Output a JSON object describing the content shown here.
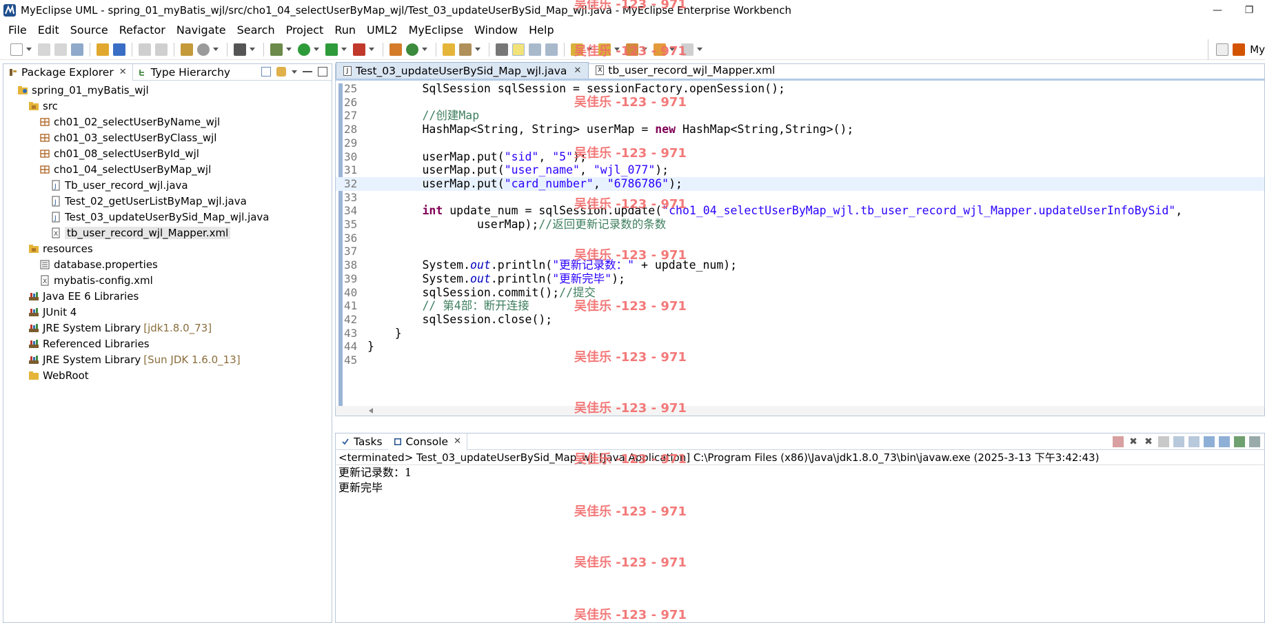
{
  "window": {
    "title": "MyEclipse UML - spring_01_myBatis_wjl/src/cho1_04_selectUserByMap_wjl/Test_03_updateUserBySid_Map_wjl.java - MyEclipse Enterprise Workbench",
    "minimize": "—",
    "restore": "❐"
  },
  "menu": [
    "File",
    "Edit",
    "Source",
    "Refactor",
    "Navigate",
    "Search",
    "Project",
    "Run",
    "UML2",
    "MyEclipse",
    "Window",
    "Help"
  ],
  "perspective": {
    "label": "My"
  },
  "left_panel": {
    "tabs": [
      {
        "label": "Package Explorer",
        "close": "✕"
      },
      {
        "label": "Type Hierarchy"
      }
    ],
    "tree": [
      {
        "label": "spring_01_myBatis_wjl",
        "icon": "project-icon",
        "indent": 0
      },
      {
        "label": "src",
        "icon": "source-folder-icon",
        "indent": 1
      },
      {
        "label": "ch01_02_selectUserByName_wjl",
        "icon": "package-icon",
        "indent": 2
      },
      {
        "label": "ch01_03_selectUserByClass_wjl",
        "icon": "package-icon",
        "indent": 2
      },
      {
        "label": "ch01_08_selectUserById_wjl",
        "icon": "package-icon",
        "indent": 2
      },
      {
        "label": "cho1_04_selectUserByMap_wjl",
        "icon": "package-icon",
        "indent": 2
      },
      {
        "label": "Tb_user_record_wjl.java",
        "icon": "java-file-icon",
        "indent": 3
      },
      {
        "label": "Test_02_getUserListByMap_wjl.java",
        "icon": "java-file-icon",
        "indent": 3
      },
      {
        "label": "Test_03_updateUserBySid_Map_wjl.java",
        "icon": "java-file-icon",
        "indent": 3
      },
      {
        "label": "tb_user_record_wjl_Mapper.xml",
        "icon": "xml-file-icon",
        "indent": 3,
        "selected": true
      },
      {
        "label": "resources",
        "icon": "source-folder-icon",
        "indent": 1
      },
      {
        "label": "database.properties",
        "icon": "properties-file-icon",
        "indent": 2
      },
      {
        "label": "mybatis-config.xml",
        "icon": "xml-file-icon",
        "indent": 2
      },
      {
        "label": "Java EE 6 Libraries",
        "icon": "library-icon",
        "indent": 1
      },
      {
        "label": "JUnit 4",
        "icon": "library-icon",
        "indent": 1
      },
      {
        "label": "JRE System Library",
        "suffix": "[jdk1.8.0_73]",
        "icon": "library-icon",
        "indent": 1
      },
      {
        "label": "Referenced Libraries",
        "icon": "library-icon",
        "indent": 1
      },
      {
        "label": "JRE System Library",
        "suffix": "[Sun JDK 1.6.0_13]",
        "icon": "library-icon",
        "indent": 1
      },
      {
        "label": "WebRoot",
        "icon": "folder-icon",
        "indent": 1
      }
    ]
  },
  "editor": {
    "tabs": [
      {
        "label": "Test_03_updateUserBySid_Map_wjl.java",
        "type": "J",
        "active": true,
        "close": "✕"
      },
      {
        "label": "tb_user_record_wjl_Mapper.xml",
        "type": "X",
        "active": false
      }
    ],
    "current_line": 32,
    "lines": [
      {
        "n": "25",
        "segs": [
          [
            "",
            "        SqlSession sqlSession = sessionFactory.openSession();"
          ]
        ]
      },
      {
        "n": "26",
        "segs": []
      },
      {
        "n": "27",
        "segs": [
          [
            "cmt",
            "        //创建Map"
          ]
        ]
      },
      {
        "n": "28",
        "segs": [
          [
            "",
            "        HashMap<String, String> userMap = "
          ],
          [
            "kw",
            "new"
          ],
          [
            "",
            " HashMap<String,String>();"
          ]
        ]
      },
      {
        "n": "29",
        "segs": []
      },
      {
        "n": "30",
        "segs": [
          [
            "",
            "        userMap.put("
          ],
          [
            "str",
            "\"sid\""
          ],
          [
            "",
            ", "
          ],
          [
            "str",
            "\"5\""
          ],
          [
            "",
            ");"
          ]
        ]
      },
      {
        "n": "31",
        "segs": [
          [
            "",
            "        userMap.put("
          ],
          [
            "str",
            "\"user_name\""
          ],
          [
            "",
            ", "
          ],
          [
            "str",
            "\"wjl_077\""
          ],
          [
            "",
            ");"
          ]
        ]
      },
      {
        "n": "32",
        "segs": [
          [
            "",
            "        userMap.put("
          ],
          [
            "str",
            "\"card_number\""
          ],
          [
            "",
            ", "
          ],
          [
            "str",
            "\"6786786\""
          ],
          [
            "",
            ");"
          ]
        ]
      },
      {
        "n": "33",
        "segs": []
      },
      {
        "n": "34",
        "segs": [
          [
            "kw",
            "        int"
          ],
          [
            "",
            " update_num = sqlSession.update("
          ],
          [
            "str",
            "\"cho1_04_selectUserByMap_wjl.tb_user_record_wjl_Mapper.updateUserInfoBySid\""
          ],
          [
            "",
            ","
          ]
        ]
      },
      {
        "n": "35",
        "segs": [
          [
            "",
            "                userMap);"
          ],
          [
            "cmt",
            "//返回更新记录数的条数"
          ]
        ]
      },
      {
        "n": "36",
        "segs": []
      },
      {
        "n": "37",
        "segs": []
      },
      {
        "n": "38",
        "segs": [
          [
            "",
            "        System."
          ],
          [
            "fld",
            "out"
          ],
          [
            "",
            ".println("
          ],
          [
            "str",
            "\"更新记录数：\""
          ],
          [
            "",
            " + update_num);"
          ]
        ]
      },
      {
        "n": "39",
        "segs": [
          [
            "",
            "        System."
          ],
          [
            "fld",
            "out"
          ],
          [
            "",
            ".println("
          ],
          [
            "str",
            "\"更新完毕\""
          ],
          [
            "",
            ");"
          ]
        ]
      },
      {
        "n": "40",
        "segs": [
          [
            "",
            "        sqlSession.commit();"
          ],
          [
            "cmt",
            "//提交"
          ]
        ]
      },
      {
        "n": "41",
        "segs": [
          [
            "cmt",
            "        // 第4部：断开连接"
          ]
        ]
      },
      {
        "n": "42",
        "segs": [
          [
            "",
            "        sqlSession.close();"
          ]
        ]
      },
      {
        "n": "43",
        "segs": [
          [
            "",
            "    }"
          ]
        ]
      },
      {
        "n": "44",
        "segs": [
          [
            "",
            "}"
          ]
        ]
      },
      {
        "n": "45",
        "segs": []
      }
    ]
  },
  "console": {
    "tabs": [
      {
        "label": "Tasks"
      },
      {
        "label": "Console",
        "active": true,
        "close": "✕"
      }
    ],
    "header": "<terminated> Test_03_updateUserBySid_Map_wjl [Java Application] C:\\Program Files (x86)\\Java\\jdk1.8.0_73\\bin\\javaw.exe (2025-3-13 下午3:42:43)",
    "output": [
      "更新记录数：1",
      "更新完毕"
    ]
  },
  "watermark": {
    "text": "吴佳乐 -123 - 971",
    "color": "#f26b6b"
  },
  "colors": {
    "keyword": "#7f0055",
    "string": "#2a00ff",
    "comment": "#3f7f5f",
    "current_line": "#e8f2fe",
    "library_suffix": "#8a6d3b"
  }
}
